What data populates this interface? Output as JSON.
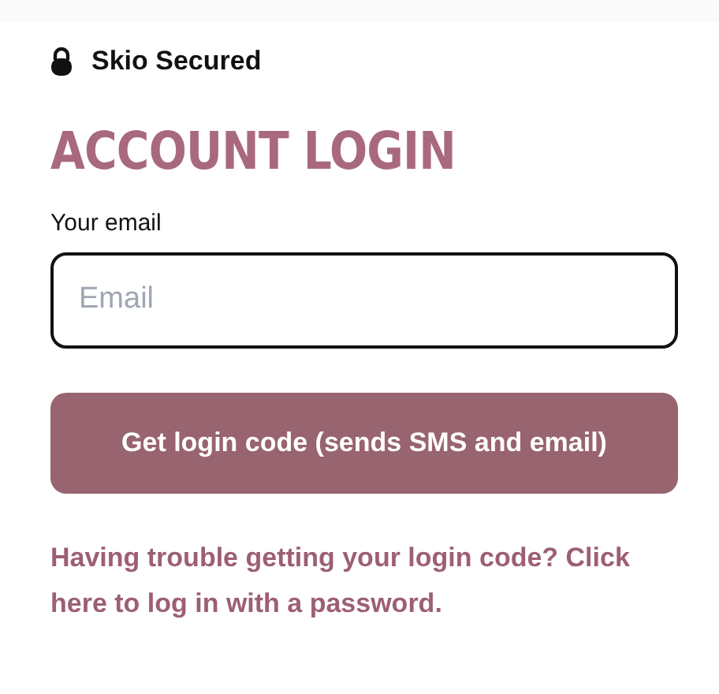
{
  "header": {
    "secured_label": "Skio Secured"
  },
  "title": "ACCOUNT LOGIN",
  "email_field": {
    "label": "Your email",
    "placeholder": "Email"
  },
  "submit_button": "Get login code (sends SMS and email)",
  "help_link": "Having trouble getting your login code? Click here to log in with a password."
}
